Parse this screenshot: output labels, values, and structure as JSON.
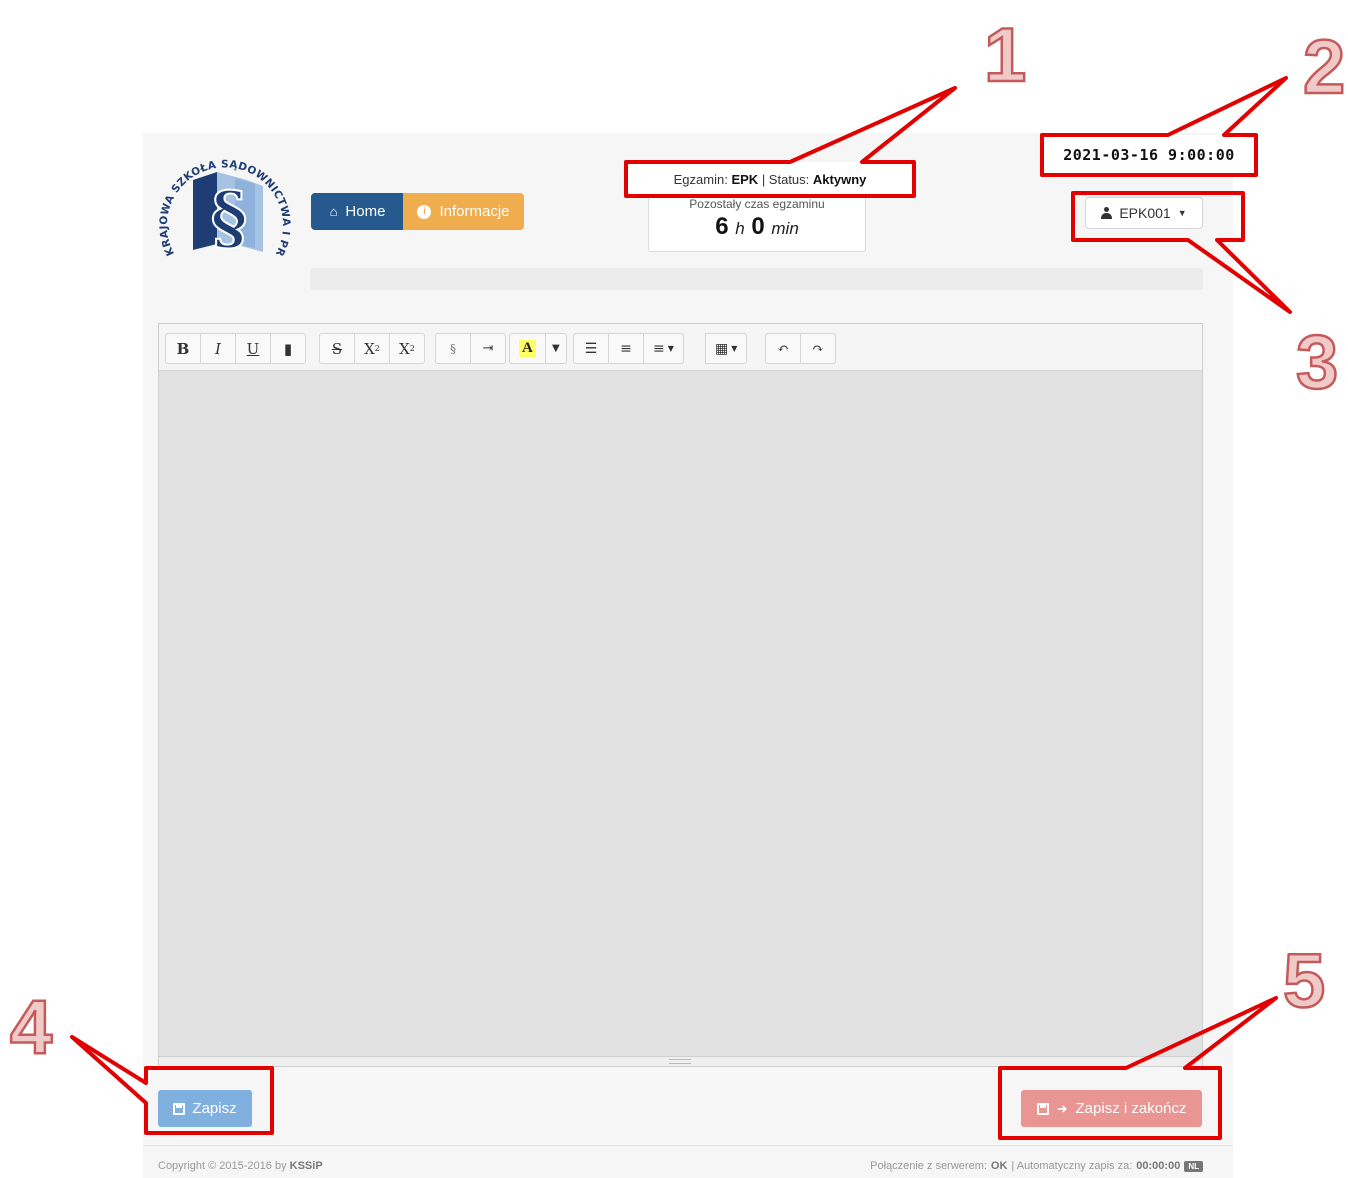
{
  "logo": {
    "arc_text": "KRAJOWA SZKOŁA SĄDOWNICTWA I PROKURATURY",
    "symbol": "§"
  },
  "nav": {
    "home_label": "Home",
    "info_label": "Informacje"
  },
  "exam": {
    "label_exam": "Egzamin:",
    "exam_name": "EPK",
    "label_status": "| Status:",
    "status_value": "Aktywny",
    "remaining_label": "Pozostały czas egzaminu",
    "hours": "6",
    "hours_unit": "h",
    "minutes": "0",
    "minutes_unit": "min"
  },
  "datetime": "2021-03-16 9:00:00",
  "user": {
    "name": "EPK001"
  },
  "toolbar": {
    "bold": "B",
    "italic": "I",
    "underline": "U",
    "strike": "S",
    "superscript": "X",
    "subscript": "X",
    "paragraph": "§",
    "highlight": "A"
  },
  "actions": {
    "save_label": "Zapisz",
    "save_finish_label": "Zapisz i zakończ"
  },
  "footer": {
    "copyright_prefix": "Copyright © 2015-2016 by",
    "copyright_owner": "KSSiP",
    "connection_prefix": "Połączenie z serwerem:",
    "connection_status": "OK",
    "autosave_prefix": "| Automatyczny zapis za:",
    "autosave_time": "00:00:00",
    "badge": "NL"
  },
  "annotations": [
    "1",
    "2",
    "3",
    "4",
    "5"
  ],
  "colors": {
    "home": "#265a8e",
    "info": "#f0ad4e",
    "save": "#7fb0e0",
    "save_finish": "#e89593",
    "callout": "#e30000"
  }
}
